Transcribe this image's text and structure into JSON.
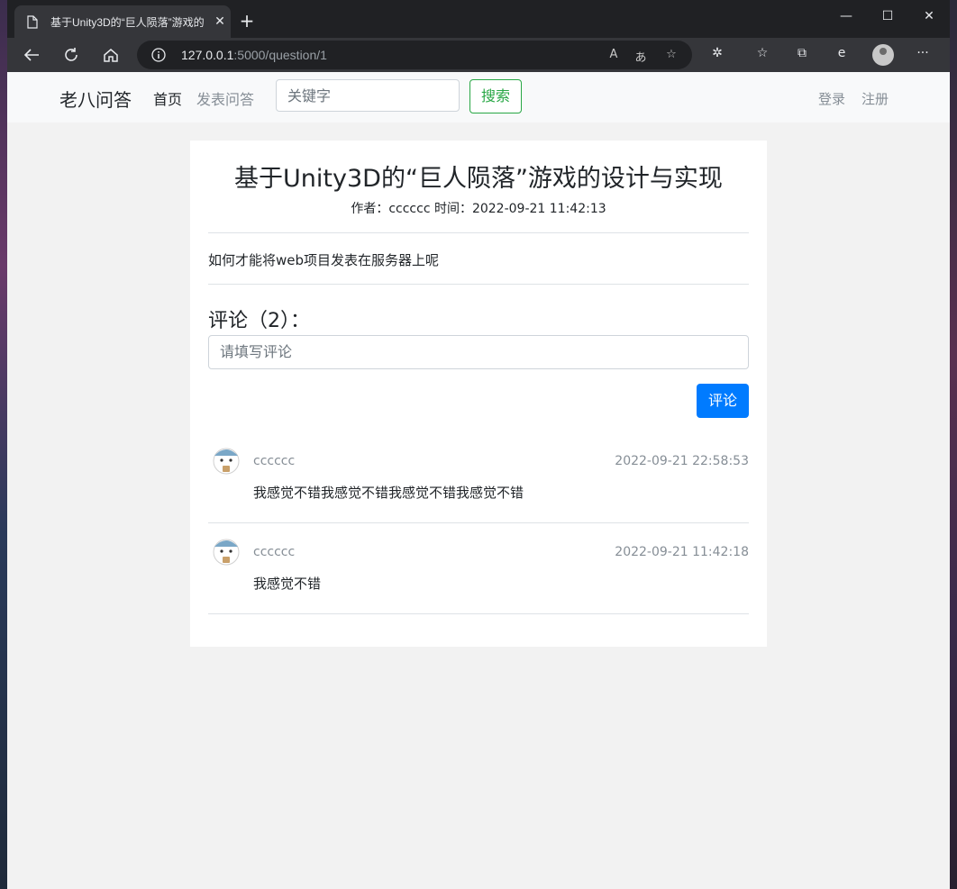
{
  "browser": {
    "tab_title": "基于Unity3D的“巨人陨落”游戏的",
    "url_host": "127.0.0.1",
    "url_path": ":5000/question/1"
  },
  "site": {
    "brand": "老八问答",
    "nav_home": "首页",
    "nav_post": "发表问答",
    "search_placeholder": "关键字",
    "search_button": "搜索",
    "login": "登录",
    "register": "注册"
  },
  "question": {
    "title": "基于Unity3D的“巨人陨落”游戏的设计与实现",
    "meta": "作者：cccccc 时间：2022-09-21 11:42:13",
    "content": "如何才能将web项目发表在服务器上呢"
  },
  "comments_section": {
    "heading": "评论（2）：",
    "input_placeholder": "请填写评论",
    "submit_button": "评论",
    "items": [
      {
        "user": "cccccc",
        "time": "2022-09-21 22:58:53",
        "text": "我感觉不错我感觉不错我感觉不错我感觉不错"
      },
      {
        "user": "cccccc",
        "time": "2022-09-21 11:42:18",
        "text": "我感觉不错"
      }
    ]
  },
  "colors": {
    "primary": "#007bff",
    "success": "#28a745",
    "muted": "#868e96",
    "page_bg": "#f2f2f2"
  }
}
